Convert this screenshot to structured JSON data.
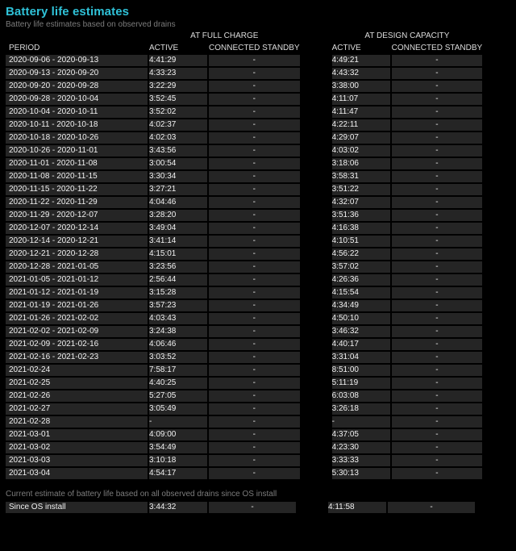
{
  "title": "Battery life estimates",
  "subtitle": "Battery life estimates based on observed drains",
  "group_headers": {
    "full": "AT FULL CHARGE",
    "design": "AT DESIGN CAPACITY"
  },
  "columns": {
    "period": "PERIOD",
    "active_full": "ACTIVE",
    "standby_full": "CONNECTED STANDBY",
    "active_design": "ACTIVE",
    "standby_design": "CONNECTED STANDBY"
  },
  "rows": [
    {
      "period": "2020-09-06 - 2020-09-13",
      "active_full": "4:41:29",
      "standby_full": "-",
      "active_design": "4:49:21",
      "standby_design": "-"
    },
    {
      "period": "2020-09-13 - 2020-09-20",
      "active_full": "4:33:23",
      "standby_full": "-",
      "active_design": "4:43:32",
      "standby_design": "-"
    },
    {
      "period": "2020-09-20 - 2020-09-28",
      "active_full": "3:22:29",
      "standby_full": "-",
      "active_design": "3:38:00",
      "standby_design": "-"
    },
    {
      "period": "2020-09-28 - 2020-10-04",
      "active_full": "3:52:45",
      "standby_full": "-",
      "active_design": "4:11:07",
      "standby_design": "-"
    },
    {
      "period": "2020-10-04 - 2020-10-11",
      "active_full": "3:52:02",
      "standby_full": "-",
      "active_design": "4:11:47",
      "standby_design": "-"
    },
    {
      "period": "2020-10-11 - 2020-10-18",
      "active_full": "4:02:37",
      "standby_full": "-",
      "active_design": "4:22:11",
      "standby_design": "-"
    },
    {
      "period": "2020-10-18 - 2020-10-26",
      "active_full": "4:02:03",
      "standby_full": "-",
      "active_design": "4:29:07",
      "standby_design": "-"
    },
    {
      "period": "2020-10-26 - 2020-11-01",
      "active_full": "3:43:56",
      "standby_full": "-",
      "active_design": "4:03:02",
      "standby_design": "-"
    },
    {
      "period": "2020-11-01 - 2020-11-08",
      "active_full": "3:00:54",
      "standby_full": "-",
      "active_design": "3:18:06",
      "standby_design": "-"
    },
    {
      "period": "2020-11-08 - 2020-11-15",
      "active_full": "3:30:34",
      "standby_full": "-",
      "active_design": "3:58:31",
      "standby_design": "-"
    },
    {
      "period": "2020-11-15 - 2020-11-22",
      "active_full": "3:27:21",
      "standby_full": "-",
      "active_design": "3:51:22",
      "standby_design": "-"
    },
    {
      "period": "2020-11-22 - 2020-11-29",
      "active_full": "4:04:46",
      "standby_full": "-",
      "active_design": "4:32:07",
      "standby_design": "-"
    },
    {
      "period": "2020-11-29 - 2020-12-07",
      "active_full": "3:28:20",
      "standby_full": "-",
      "active_design": "3:51:36",
      "standby_design": "-"
    },
    {
      "period": "2020-12-07 - 2020-12-14",
      "active_full": "3:49:04",
      "standby_full": "-",
      "active_design": "4:16:38",
      "standby_design": "-"
    },
    {
      "period": "2020-12-14 - 2020-12-21",
      "active_full": "3:41:14",
      "standby_full": "-",
      "active_design": "4:10:51",
      "standby_design": "-"
    },
    {
      "period": "2020-12-21 - 2020-12-28",
      "active_full": "4:15:01",
      "standby_full": "-",
      "active_design": "4:56:22",
      "standby_design": "-"
    },
    {
      "period": "2020-12-28 - 2021-01-05",
      "active_full": "3:23:56",
      "standby_full": "-",
      "active_design": "3:57:02",
      "standby_design": "-"
    },
    {
      "period": "2021-01-05 - 2021-01-12",
      "active_full": "2:56:44",
      "standby_full": "-",
      "active_design": "4:26:36",
      "standby_design": "-"
    },
    {
      "period": "2021-01-12 - 2021-01-19",
      "active_full": "3:15:28",
      "standby_full": "-",
      "active_design": "4:15:54",
      "standby_design": "-"
    },
    {
      "period": "2021-01-19 - 2021-01-26",
      "active_full": "3:57:23",
      "standby_full": "-",
      "active_design": "4:34:49",
      "standby_design": "-"
    },
    {
      "period": "2021-01-26 - 2021-02-02",
      "active_full": "4:03:43",
      "standby_full": "-",
      "active_design": "4:50:10",
      "standby_design": "-"
    },
    {
      "period": "2021-02-02 - 2021-02-09",
      "active_full": "3:24:38",
      "standby_full": "-",
      "active_design": "3:46:32",
      "standby_design": "-"
    },
    {
      "period": "2021-02-09 - 2021-02-16",
      "active_full": "4:06:46",
      "standby_full": "-",
      "active_design": "4:40:17",
      "standby_design": "-"
    },
    {
      "period": "2021-02-16 - 2021-02-23",
      "active_full": "3:03:52",
      "standby_full": "-",
      "active_design": "3:31:04",
      "standby_design": "-"
    },
    {
      "period": "2021-02-24",
      "active_full": "7:58:17",
      "standby_full": "-",
      "active_design": "8:51:00",
      "standby_design": "-"
    },
    {
      "period": "2021-02-25",
      "active_full": "4:40:25",
      "standby_full": "-",
      "active_design": "5:11:19",
      "standby_design": "-"
    },
    {
      "period": "2021-02-26",
      "active_full": "5:27:05",
      "standby_full": "-",
      "active_design": "6:03:08",
      "standby_design": "-"
    },
    {
      "period": "2021-02-27",
      "active_full": "3:05:49",
      "standby_full": "-",
      "active_design": "3:26:18",
      "standby_design": "-"
    },
    {
      "period": "2021-02-28",
      "active_full": "-",
      "standby_full": "-",
      "active_design": "-",
      "standby_design": "-"
    },
    {
      "period": "2021-03-01",
      "active_full": "4:09:00",
      "standby_full": "-",
      "active_design": "4:37:05",
      "standby_design": "-"
    },
    {
      "period": "2021-03-02",
      "active_full": "3:54:49",
      "standby_full": "-",
      "active_design": "4:23:30",
      "standby_design": "-"
    },
    {
      "period": "2021-03-03",
      "active_full": "3:10:18",
      "standby_full": "-",
      "active_design": "3:33:33",
      "standby_design": "-"
    },
    {
      "period": "2021-03-04",
      "active_full": "4:54:17",
      "standby_full": "-",
      "active_design": "5:30:13",
      "standby_design": "-"
    }
  ],
  "current_note": "Current estimate of battery life based on all observed drains since OS install",
  "since_install": {
    "period": "Since OS install",
    "active_full": "3:44:32",
    "standby_full": "-",
    "active_design": "4:11:58",
    "standby_design": "-"
  }
}
